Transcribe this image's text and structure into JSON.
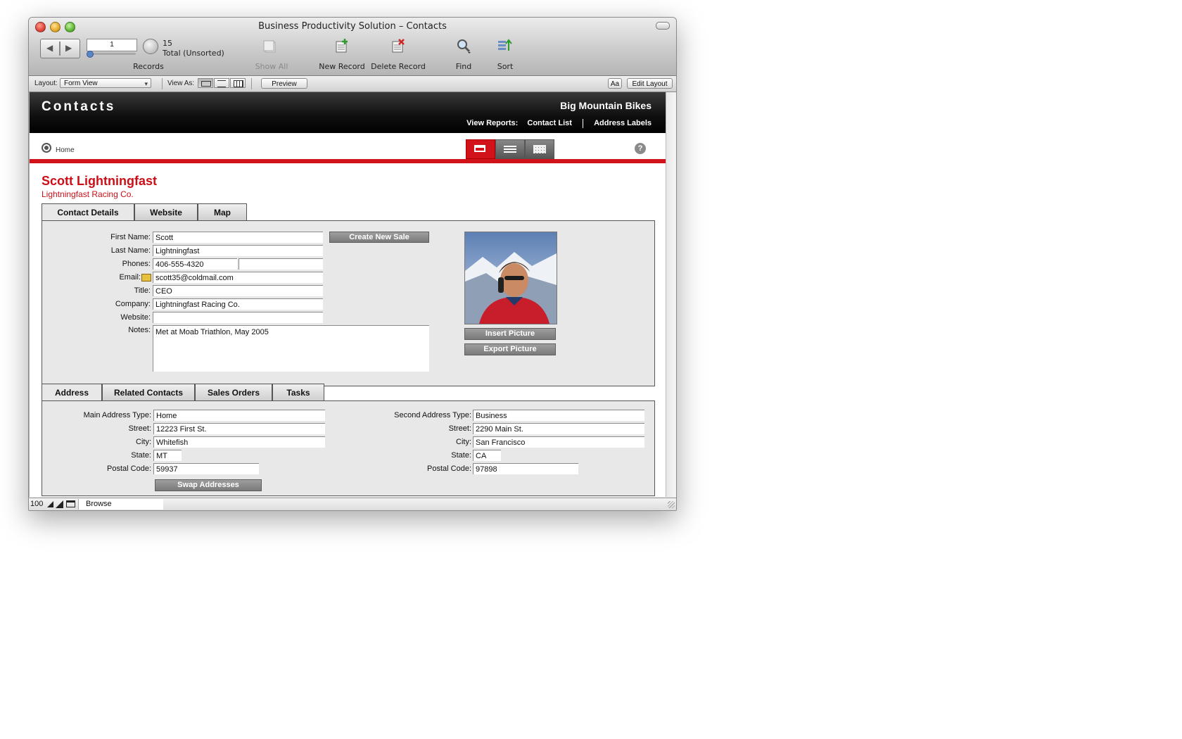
{
  "window": {
    "title": "Business Productivity Solution – Contacts"
  },
  "toolbar": {
    "record_number": "1",
    "records_label": "Records",
    "found_count": "15",
    "total_label": "Total (Unsorted)",
    "show_all": "Show All",
    "new_record": "New Record",
    "delete_record": "Delete Record",
    "find": "Find",
    "sort": "Sort"
  },
  "layout_bar": {
    "layout_label": "Layout:",
    "layout_value": "Form View",
    "view_as_label": "View As:",
    "preview": "Preview",
    "text_format": "Aa",
    "edit_layout": "Edit Layout"
  },
  "header": {
    "title": "Contacts",
    "company": "Big Mountain Bikes",
    "reports_label": "View Reports:",
    "report_contact_list": "Contact List",
    "report_address_labels": "Address Labels"
  },
  "nav": {
    "home": "Home",
    "help": "?"
  },
  "contact": {
    "full_name": "Scott Lightningfast",
    "company_line": "Lightningfast Racing Co."
  },
  "tabs_top": [
    "Contact Details",
    "Website",
    "Map"
  ],
  "details": {
    "labels": {
      "first_name": "First Name:",
      "last_name": "Last Name:",
      "phones": "Phones:",
      "email": "Email:",
      "title": "Title:",
      "company": "Company:",
      "website": "Website:",
      "notes": "Notes:"
    },
    "values": {
      "first_name": "Scott",
      "last_name": "Lightningfast",
      "phone1": "406-555-4320",
      "phone2": "",
      "email": "scott35@coldmail.com",
      "title": "CEO",
      "company": "Lightningfast Racing Co.",
      "website": "",
      "notes": "Met at Moab Triathlon, May 2005"
    },
    "create_new_sale": "Create New Sale",
    "insert_picture": "Insert Picture",
    "export_picture": "Export Picture"
  },
  "tabs_bottom": [
    "Address",
    "Related Contacts",
    "Sales Orders",
    "Tasks"
  ],
  "address": {
    "main_labels": {
      "type": "Main Address Type:",
      "street": "Street:",
      "city": "City:",
      "state": "State:",
      "postal": "Postal Code:"
    },
    "main": {
      "type": "Home",
      "street": "12223 First St.",
      "city": "Whitefish",
      "state": "MT",
      "postal": "59937"
    },
    "second_labels": {
      "type": "Second Address Type:",
      "street": "Street:",
      "city": "City:",
      "state": "State:",
      "postal": "Postal Code:"
    },
    "second": {
      "type": "Business",
      "street": "2290 Main St.",
      "city": "San Francisco",
      "state": "CA",
      "postal": "97898"
    },
    "swap": "Swap Addresses"
  },
  "status": {
    "zoom": "100",
    "mode": "Browse"
  }
}
